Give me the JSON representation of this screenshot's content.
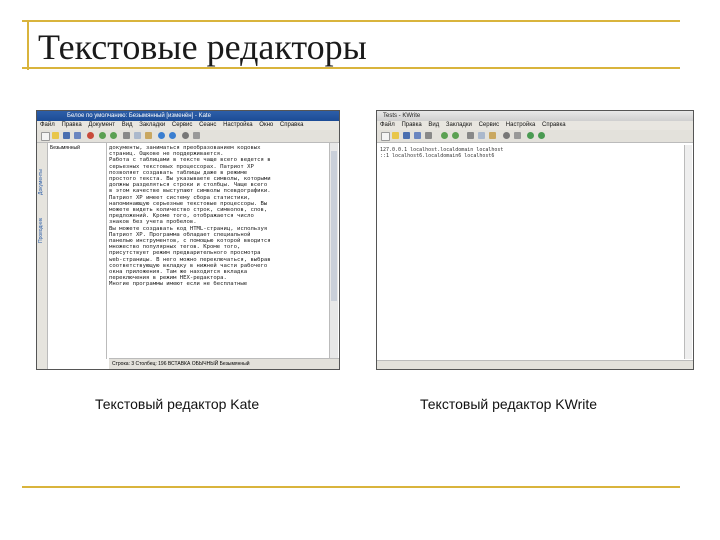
{
  "slide": {
    "title": "Текстовые редакторы"
  },
  "kate": {
    "window_title": "Белое по умолчанию: Безымянный [изменён] - Kate",
    "menu": [
      "Файл",
      "Правка",
      "Документ",
      "Вид",
      "Закладки",
      "Сервис",
      "Сеанс",
      "Настройка",
      "Окно",
      "Справка"
    ],
    "side_tabs": [
      "Документы",
      "Проводник"
    ],
    "file_item": "Безымянный",
    "text_lines": [
      "документы, заниматься преобразованием кодовых",
      "страниц. Ощкове не поддерживается.",
      "Работа с таблицами в тексте чаще всего ведется в",
      "серьезных текстовых процессорах. Патриот XP",
      "позволяет создавать таблицы даже в режиме",
      "простого текста. Вы указываете символы, которыми",
      "должны разделяться строки и столбцы. Чаще всего",
      "в этом качестве выступают символы псевдографики.",
      "Патриот XP имеет систему сбора статистики,",
      "напоминающую серьезные текстовые процессоры. Вы",
      "можете видеть количество строк, символов, слов,",
      "предложений. Кроме того, отображается число",
      "знаков без учета пробелов.",
      "Вы можете создавать код HTML-страниц, используя",
      "Патриот XP. Программа обладает специальной",
      "панелью инструментов, с помощью которой вводится",
      "множество популярных тегов. Кроме того,",
      "присутствует режим предварительного просмотра",
      "web-страницы. В него можно переключаться, выбрав",
      "соответствующую вкладку в нижней части рабочего",
      "окна приложения. Там же находится вкладка",
      "переключения в режим HEX-редактора.",
      "Mногие программы имеют если не бесплатные"
    ],
    "status": "Строка: 3 Столбец: 196   ВСТАВКА   ОБЫЧНЫЙ  Безымянный"
  },
  "kwrite": {
    "window_title": "Tests - KWrite",
    "menu": [
      "Файл",
      "Правка",
      "Вид",
      "Закладки",
      "Сервис",
      "Настройка",
      "Справка"
    ],
    "text_lines": [
      "127.0.0.1        localhost.localdomain localhost",
      "::1              localhost6.localdomain6 localhost6"
    ]
  },
  "captions": {
    "left": "Текстовый редактор Kate",
    "right": "Текстовый редактор KWrite"
  },
  "colors": {
    "accent_line": "#d9b43c",
    "kate_titlebar": "#2d5ea8"
  }
}
